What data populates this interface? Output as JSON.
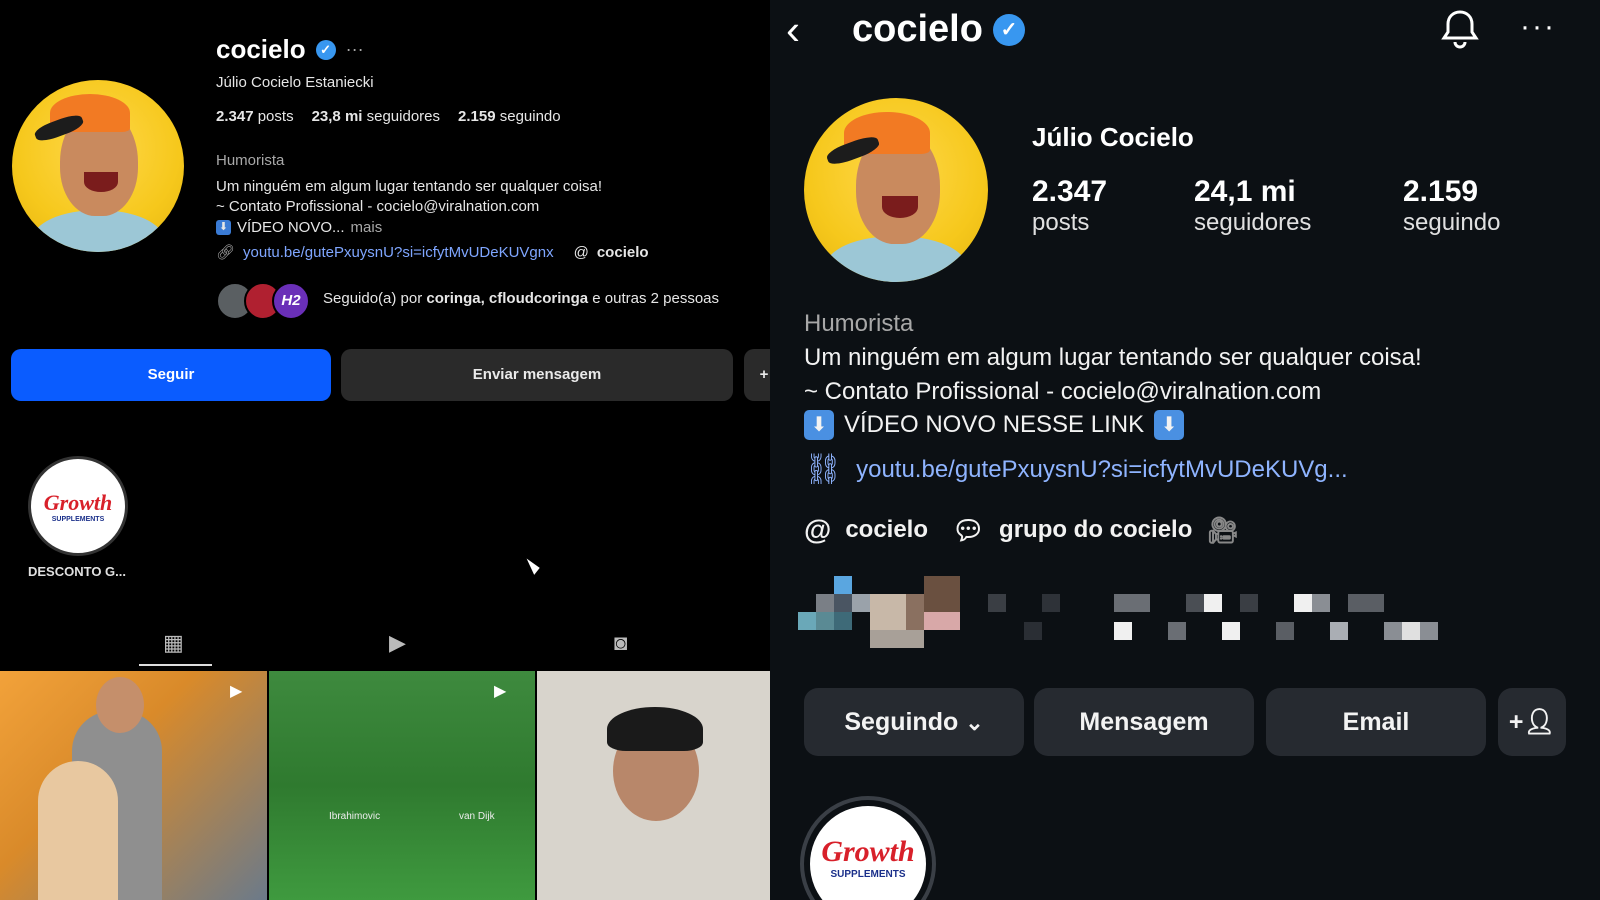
{
  "left": {
    "username": "cocielo",
    "more": "···",
    "full_name": "Júlio Cocielo Estaniecki",
    "stats": {
      "posts_num": "2.347",
      "posts_label": "posts",
      "followers_num": "23,8 mi",
      "followers_label": "seguidores",
      "following_num": "2.159",
      "following_label": "seguindo"
    },
    "category": "Humorista",
    "bio_line1": "Um ninguém em algum lugar tentando ser qualquer coisa!",
    "bio_line2": "~ Contato Profissional - cocielo@viralnation.com",
    "bio_line3": "VÍDEO NOVO...",
    "bio_more": "mais",
    "link": "youtu.be/gutePxuysnU?si=icfytMvUDeKUVgnx",
    "threads": "cocielo",
    "followed_by_prefix": "Seguido(a) por",
    "followed_by_names": "coringa, cfloudcoringa",
    "followed_by_suffix": "e outras 2 pessoas",
    "follow_button": "Seguir",
    "message_button": "Enviar mensagem",
    "highlight_label": "DESCONTO G...",
    "highlight_logo_1": "Growth",
    "highlight_logo_2": "SUPPLEMENTS",
    "thumb_labels": [
      "Ibrahimovic",
      "van Dijk"
    ]
  },
  "right": {
    "username": "cocielo",
    "full_name": "Júlio Cocielo",
    "stats": {
      "posts_num": "2.347",
      "posts_label": "posts",
      "followers_num": "24,1 mi",
      "followers_label": "seguidores",
      "following_num": "2.159",
      "following_label": "seguindo"
    },
    "category": "Humorista",
    "bio_line1": "Um ninguém em algum lugar tentando ser qualquer coisa!",
    "bio_line2": "~ Contato Profissional - cocielo@viralnation.com",
    "bio_line3": "VÍDEO NOVO NESSE LINK",
    "link": "youtu.be/gutePxuysnU?si=icfytMvUDeKUVg...",
    "threads": "cocielo",
    "group": "grupo do cocielo",
    "following_button": "Seguindo",
    "message_button": "Mensagem",
    "email_button": "Email",
    "highlight_logo_1": "Growth",
    "highlight_logo_2": "SUPPLEMENTS"
  },
  "colors": {
    "accent_blue": "#0a5cff",
    "verified": "#3897f0",
    "link": "#8fb4ff"
  }
}
